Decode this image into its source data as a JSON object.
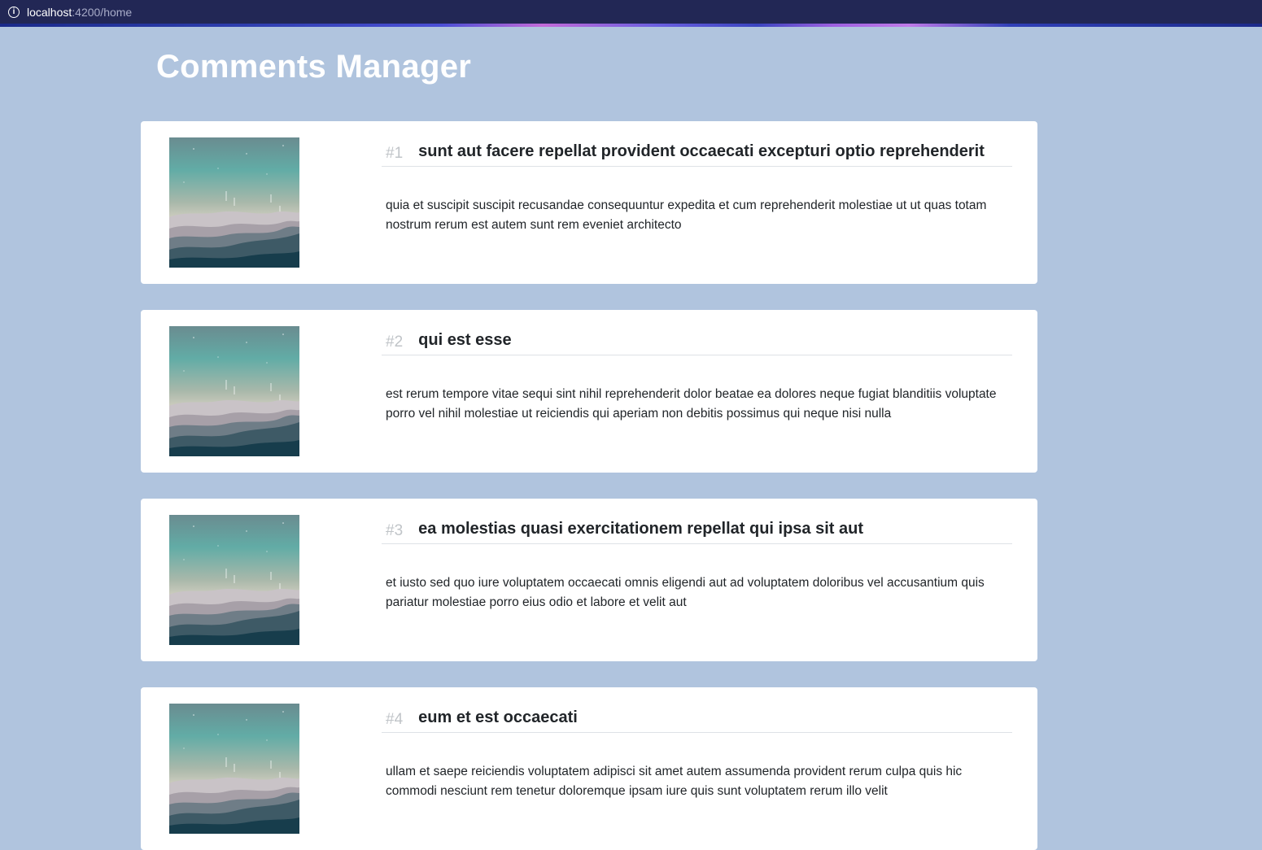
{
  "browser": {
    "url_host": "localhost",
    "url_path": ":4200/home"
  },
  "page": {
    "title": "Comments Manager"
  },
  "comments": [
    {
      "number": "#1",
      "title": "sunt aut facere repellat provident occaecati excepturi optio reprehenderit",
      "body": "quia et suscipit suscipit recusandae consequuntur expedita et cum reprehenderit molestiae ut ut quas totam nostrum rerum est autem sunt rem eveniet architecto"
    },
    {
      "number": "#2",
      "title": "qui est esse",
      "body": "est rerum tempore vitae sequi sint nihil reprehenderit dolor beatae ea dolores neque fugiat blanditiis voluptate porro vel nihil molestiae ut reiciendis qui aperiam non debitis possimus qui neque nisi nulla"
    },
    {
      "number": "#3",
      "title": "ea molestias quasi exercitationem repellat qui ipsa sit aut",
      "body": "et iusto sed quo iure voluptatem occaecati omnis eligendi aut ad voluptatem doloribus vel accusantium quis pariatur molestiae porro eius odio et labore et velit aut"
    },
    {
      "number": "#4",
      "title": "eum et est occaecati",
      "body": "ullam et saepe reiciendis voluptatem adipisci sit amet autem assumenda provident rerum culpa quis hic commodi nesciunt rem tenetur doloremque ipsam iure quis sunt voluptatem rerum illo velit"
    }
  ],
  "colors": {
    "background": "#b0c4de",
    "card": "#ffffff",
    "browser_bar": "#222755",
    "title_text": "#ffffff",
    "number_text": "#c0c4c8"
  },
  "icons": {
    "url_info": "info-icon",
    "thumbnail": "landscape-image"
  }
}
